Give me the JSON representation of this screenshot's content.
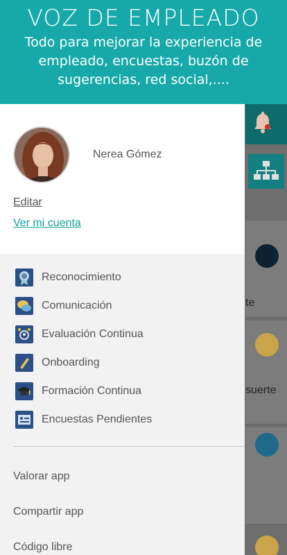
{
  "banner": {
    "title": "VOZ DE EMPLEADO",
    "subtitle": "Todo para mejorar la experiencia de empleado, encuestas, buzón de sugerencias, red social,...."
  },
  "background": {
    "partial_texts": [
      "te",
      "suerte"
    ]
  },
  "drawer": {
    "user_name": "Nerea Gómez",
    "edit_label": "Editar",
    "account_label": "Ver mi cuenta",
    "menu_items": [
      {
        "label": "Reconocimiento",
        "icon": "medal-icon"
      },
      {
        "label": "Comunicación",
        "icon": "chat-bubbles-icon"
      },
      {
        "label": "Evaluación Continua",
        "icon": "evaluation-icon"
      },
      {
        "label": "Onboarding",
        "icon": "pencil-icon"
      },
      {
        "label": "Formación Continua",
        "icon": "graduation-cap-icon"
      },
      {
        "label": "Encuestas Pendientes",
        "icon": "survey-icon"
      }
    ],
    "links": [
      {
        "label": "Valorar app"
      },
      {
        "label": "Compartir app"
      },
      {
        "label": "Código libre"
      }
    ]
  },
  "colors": {
    "brand_teal": "#17a9aa",
    "link_teal": "#17a0a0",
    "icon_blue": "#2b4f88"
  }
}
